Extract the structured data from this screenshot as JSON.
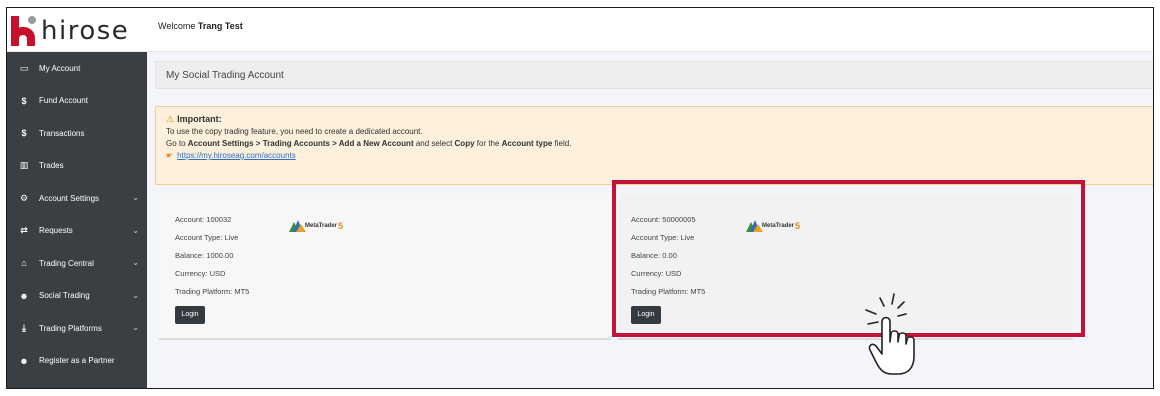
{
  "header": {
    "logo_text": "hirose",
    "welcome_prefix": "Welcome",
    "user_name": "Trang Test"
  },
  "sidebar": {
    "items": [
      {
        "label": "My Account",
        "icon": "monitor-icon",
        "glyph": "▭",
        "expandable": false
      },
      {
        "label": "Fund Account",
        "icon": "dollar-icon",
        "glyph": "$",
        "expandable": false
      },
      {
        "label": "Transactions",
        "icon": "dollar-icon",
        "glyph": "$",
        "expandable": false
      },
      {
        "label": "Trades",
        "icon": "bar-chart-icon",
        "glyph": "▥",
        "expandable": false
      },
      {
        "label": "Account Settings",
        "icon": "user-card-icon",
        "glyph": "⚙",
        "expandable": true
      },
      {
        "label": "Requests",
        "icon": "exchange-icon",
        "glyph": "⇄",
        "expandable": true
      },
      {
        "label": "Trading Central",
        "icon": "graduation-cap-icon",
        "glyph": "⌂",
        "expandable": true
      },
      {
        "label": "Social Trading",
        "icon": "users-icon",
        "glyph": "☻",
        "expandable": true
      },
      {
        "label": "Trading Platforms",
        "icon": "download-icon",
        "glyph": "⤓",
        "expandable": true
      },
      {
        "label": "Register as a Partner",
        "icon": "users-icon",
        "glyph": "☻",
        "expandable": false
      }
    ],
    "chevron": "⌄"
  },
  "page": {
    "title": "My Social Trading Account"
  },
  "alert": {
    "title": "Important:",
    "line1": "To use the copy trading feature, you need to create a dedicated account.",
    "line2_pre": "Go to ",
    "line2_b1": "Account Settings > Trading Accounts > Add a New Account",
    "line2_mid1": " and select ",
    "line2_b2": "Copy",
    "line2_mid2": " for the ",
    "line2_b3": "Account type",
    "line2_post": " field.",
    "link": "https://my.hiroseag.com/accounts"
  },
  "accounts": [
    {
      "account": "Account: 100032",
      "type": "Account Type: Live",
      "balance": "Balance: 1000.00",
      "currency": "Currency: USD",
      "platform": "Trading Platform: MT5",
      "login_label": "Login",
      "platform_logo": "MetaTrader",
      "platform_logo_num": "5"
    },
    {
      "account": "Account: 50000005",
      "type": "Account Type: Live",
      "balance": "Balance: 0.00",
      "currency": "Currency: USD",
      "platform": "Trading Platform: MT5",
      "login_label": "Login",
      "platform_logo": "MetaTrader",
      "platform_logo_num": "5"
    }
  ],
  "colors": {
    "sidebar_bg": "#3a3f44",
    "brand_red": "#c8102e",
    "highlight": "#c2133a",
    "alert_bg": "#fcefdc",
    "button_dark": "#343a40"
  }
}
